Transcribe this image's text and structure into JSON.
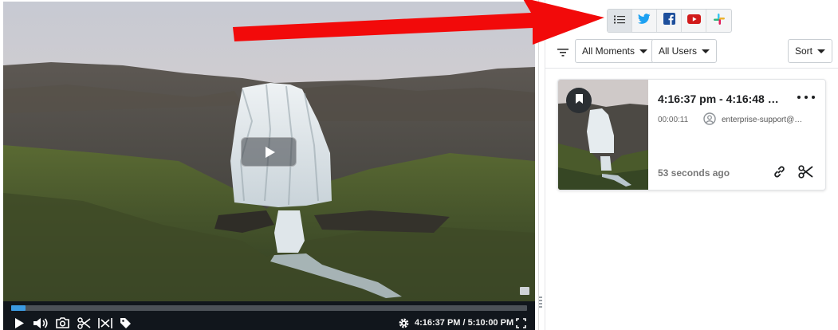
{
  "player": {
    "time_display": "4:16:37 PM / 5:10:00 PM",
    "progress_fraction": 0.028
  },
  "share_bar": {
    "items": [
      {
        "icon": "list-icon",
        "active": true
      },
      {
        "icon": "twitter-icon",
        "color": "#1da1f2"
      },
      {
        "icon": "facebook-icon",
        "color": "#1877f2"
      },
      {
        "icon": "youtube-icon",
        "color": "#e62117"
      },
      {
        "icon": "slack-icon"
      }
    ]
  },
  "filters": {
    "moments_label": "All Moments",
    "users_label": "All Users",
    "sort_label": "Sort"
  },
  "moment_card": {
    "time_range": "4:16:37 pm - 4:16:48 …",
    "duration": "00:00:11",
    "user": "enterprise-support@…",
    "age": "53 seconds ago"
  },
  "colors": {
    "annotation_arrow": "#f20a0a",
    "progress_fill": "#3b9ae1"
  }
}
